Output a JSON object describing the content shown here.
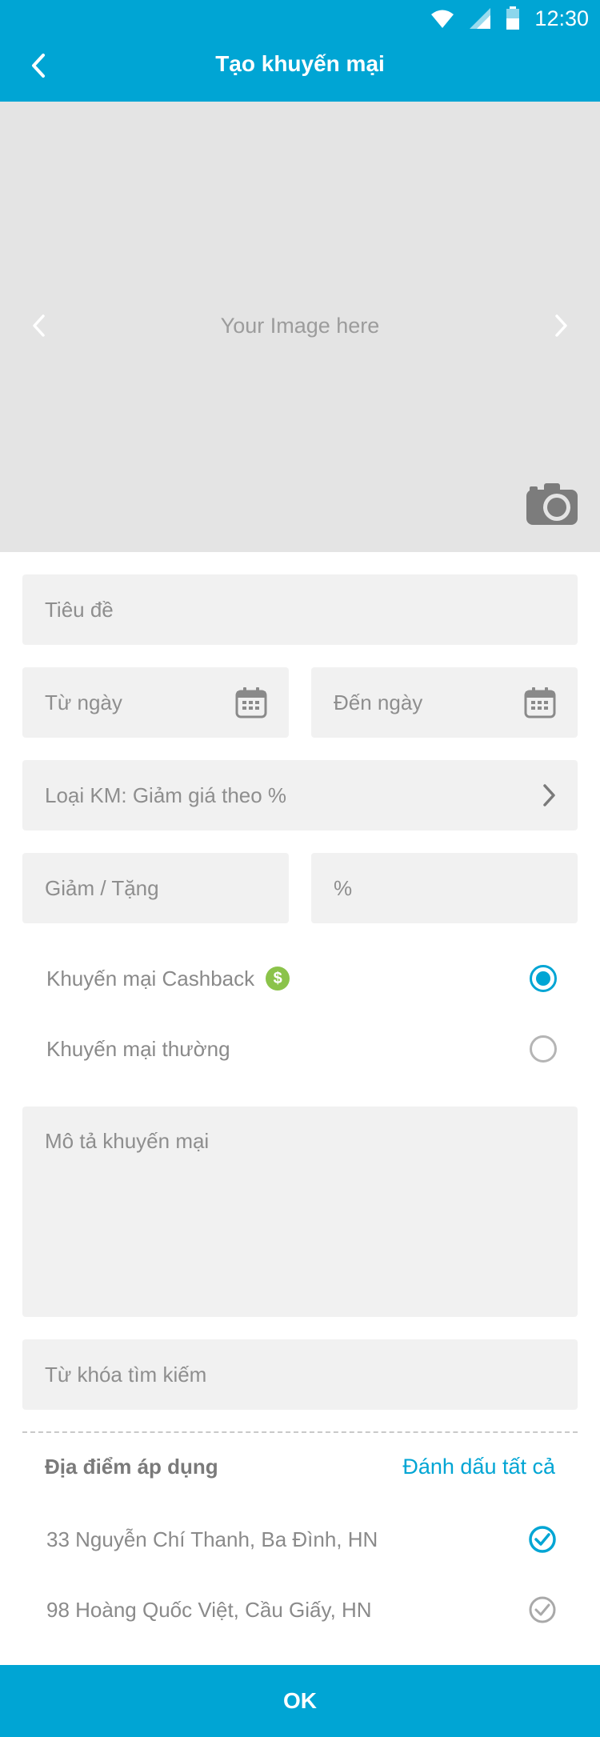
{
  "status_bar": {
    "time": "12:30"
  },
  "header": {
    "title": "Tạo khuyến mại"
  },
  "image_area": {
    "placeholder": "Your Image here"
  },
  "form": {
    "title_placeholder": "Tiêu đề",
    "from_date_placeholder": "Từ ngày",
    "to_date_placeholder": "Đến ngày",
    "promo_type_label": "Loại KM: Giảm giá theo %",
    "discount_placeholder": "Giảm / Tặng",
    "unit_placeholder": "%",
    "description_placeholder": "Mô tả khuyến mại",
    "keywords_placeholder": "Từ khóa tìm kiếm"
  },
  "promo_options": [
    {
      "label": "Khuyến mại Cashback",
      "badge": "$",
      "selected": true
    },
    {
      "label": "Khuyến mại thường",
      "selected": false
    }
  ],
  "locations": {
    "title": "Địa điểm áp dụng",
    "select_all": "Đánh dấu tất cả",
    "items": [
      {
        "label": "33 Nguyễn Chí Thanh, Ba Đình, HN",
        "checked": true
      },
      {
        "label": "98 Hoàng Quốc Việt, Cầu Giấy, HN",
        "checked": false
      }
    ]
  },
  "footer": {
    "ok_label": "OK"
  },
  "colors": {
    "accent": "#00a5d4",
    "field_bg": "#f1f1f1",
    "cashback_green": "#8bc34a"
  }
}
